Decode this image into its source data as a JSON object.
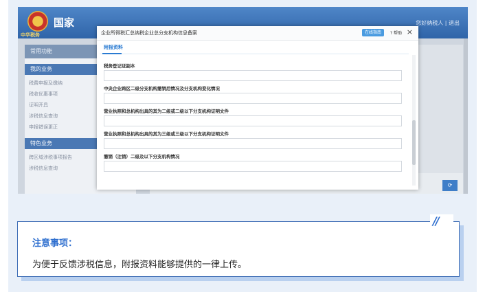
{
  "screenshot": {
    "app": {
      "title_partial": "国家",
      "subtitle": "中华税务",
      "top_right": "您好纳税人 | 退出"
    },
    "sidebar": {
      "common_label": "常用功能",
      "section_label": "我的业务",
      "items": [
        "税费申报及缴纳",
        "税收优惠事项",
        "证明开具",
        "涉税信息查询",
        "申报错误更正"
      ],
      "section2_label": "特色业务",
      "items2": [
        "跨区域涉税事项报告",
        "涉税信息查询"
      ]
    },
    "main": {
      "corner_button": "⟳"
    }
  },
  "modal": {
    "title": "企业所得税汇总纳税企业总分支机构信息备案",
    "help_button": "在线指南",
    "help_link": "? 帮助",
    "close_icon": "×",
    "tab": "附报资料",
    "fields": [
      {
        "label": "税务登记证副本"
      },
      {
        "label": "中央企业跨区二级分支机构撤销后情况及分支机构变化情况"
      },
      {
        "label": "营业执照和总机构出具的其为二级或二级以下分支机构证明文件"
      },
      {
        "label": "营业执照和总机构出具的其为三级或三级以下分支机构证明文件"
      },
      {
        "label": "撤销（注销）二级及以下分支机构情况"
      }
    ]
  },
  "notice": {
    "title": "注意事项：",
    "body": "为便于反馈涉税信息，附报资料能够提供的一律上传。",
    "deco": "//"
  },
  "colors": {
    "accent": "#2f6fcf",
    "border": "#3f6eb6",
    "shadow": "#b9d0ef",
    "background": "#e9f0f9"
  }
}
